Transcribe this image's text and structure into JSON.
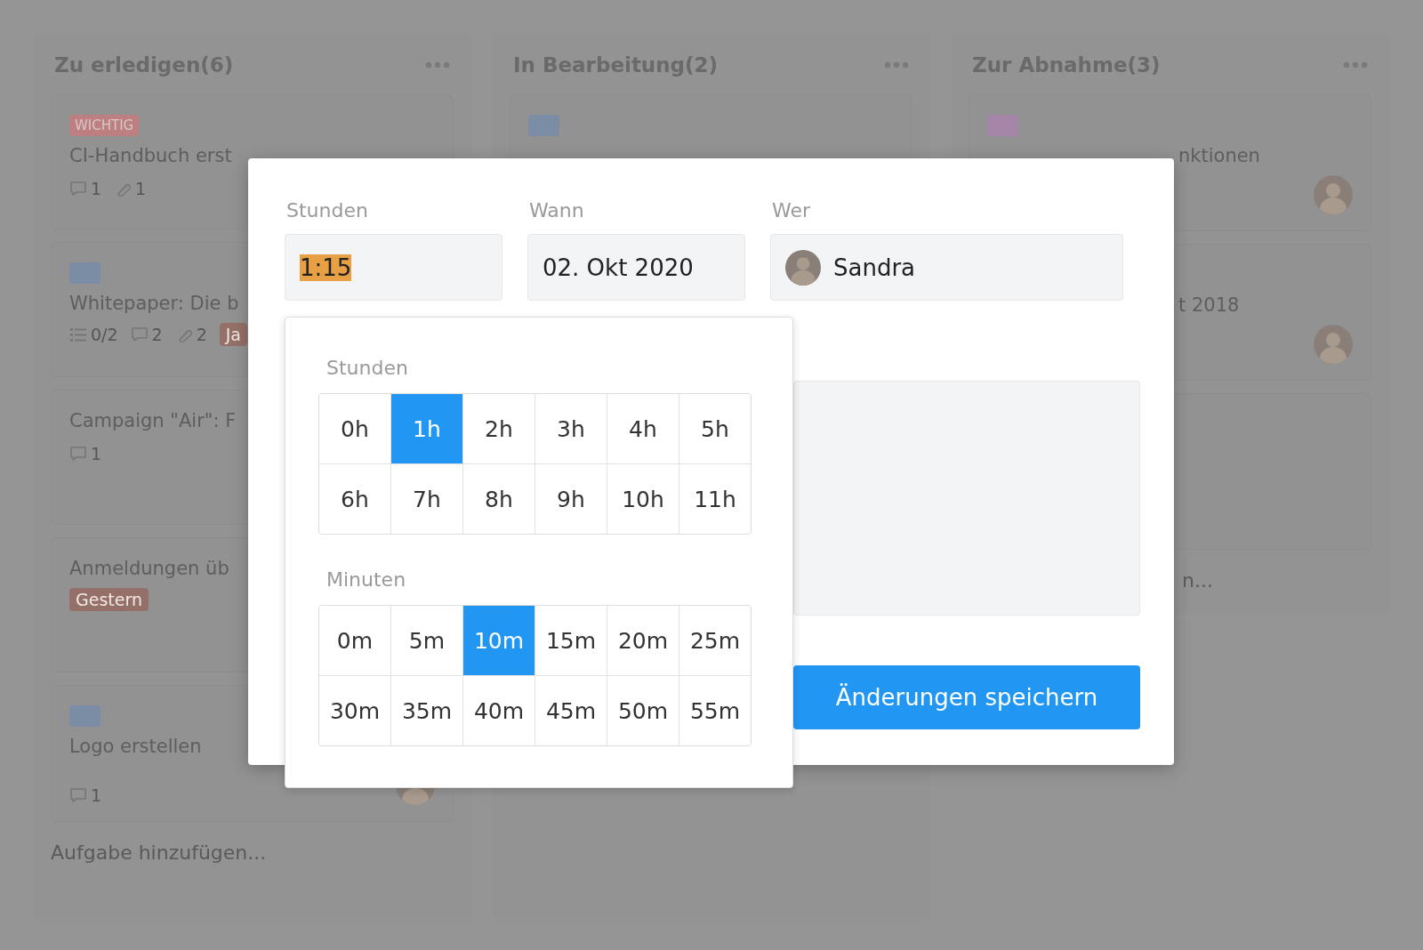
{
  "board": {
    "columns": [
      {
        "title": "Zu erledigen(6)",
        "cards": [
          {
            "tag": {
              "kind": "label",
              "text": "WICHTIG",
              "color": "#bd7f7f"
            },
            "title": "CI-Handbuch erst",
            "meta": [
              {
                "kind": "comments",
                "text": "1"
              },
              {
                "kind": "attachments",
                "text": "1"
              }
            ]
          },
          {
            "tag": {
              "kind": "swatch",
              "color": "#7b8ca5"
            },
            "title": "Whitepaper: Die b",
            "meta": [
              {
                "kind": "checklist",
                "text": "0/2"
              },
              {
                "kind": "comments",
                "text": "2"
              },
              {
                "kind": "attachments",
                "text": "2"
              },
              {
                "kind": "due",
                "text": "Ja"
              }
            ]
          },
          {
            "title": "Campaign \"Air\": F",
            "meta": [
              {
                "kind": "comments",
                "text": "1"
              }
            ]
          },
          {
            "title": "Anmeldungen üb",
            "meta": [
              {
                "kind": "due",
                "text": "Gestern"
              }
            ]
          },
          {
            "tag": {
              "kind": "swatch",
              "color": "#7b8ca5"
            },
            "title": "Logo erstellen",
            "meta": [
              {
                "kind": "comments",
                "text": "1"
              }
            ],
            "avatar": true
          }
        ],
        "add_label": "Aufgabe hinzufügen..."
      },
      {
        "title": "In Bearbeitung(2)",
        "cards": [
          {
            "tag": {
              "kind": "swatch",
              "color": "#7b8ca5"
            }
          }
        ]
      },
      {
        "title": "Zur Abnahme(3)",
        "cards": [
          {
            "tag": {
              "kind": "swatch",
              "color": "#a585a8"
            },
            "title": "nktionen",
            "avatar": true
          },
          {
            "title": "t 2018",
            "avatar": true
          },
          {
            "kind": "blank"
          }
        ],
        "add_label": "n..."
      }
    ]
  },
  "dialog": {
    "fields": [
      {
        "kind": "text",
        "label": "Stunden",
        "value": "1:15",
        "highlighted": true
      },
      {
        "kind": "text",
        "label": "Wann",
        "value": "02. Okt 2020",
        "highlighted": false
      },
      {
        "kind": "person",
        "label": "Wer",
        "value": "Sandra",
        "highlighted": false
      }
    ],
    "picker": {
      "sections": [
        {
          "label": "Stunden",
          "options": [
            {
              "label": "0h",
              "selected": false
            },
            {
              "label": "1h",
              "selected": true
            },
            {
              "label": "2h",
              "selected": false
            },
            {
              "label": "3h",
              "selected": false
            },
            {
              "label": "4h",
              "selected": false
            },
            {
              "label": "5h",
              "selected": false
            },
            {
              "label": "6h",
              "selected": false
            },
            {
              "label": "7h",
              "selected": false
            },
            {
              "label": "8h",
              "selected": false
            },
            {
              "label": "9h",
              "selected": false
            },
            {
              "label": "10h",
              "selected": false
            },
            {
              "label": "11h",
              "selected": false
            }
          ]
        },
        {
          "label": "Minuten",
          "options": [
            {
              "label": "0m",
              "selected": false
            },
            {
              "label": "5m",
              "selected": false
            },
            {
              "label": "10m",
              "selected": true
            },
            {
              "label": "15m",
              "selected": false
            },
            {
              "label": "20m",
              "selected": false
            },
            {
              "label": "25m",
              "selected": false
            },
            {
              "label": "30m",
              "selected": false
            },
            {
              "label": "35m",
              "selected": false
            },
            {
              "label": "40m",
              "selected": false
            },
            {
              "label": "45m",
              "selected": false
            },
            {
              "label": "50m",
              "selected": false
            },
            {
              "label": "55m",
              "selected": false
            }
          ]
        }
      ]
    },
    "save_button": "Änderungen speichern"
  }
}
